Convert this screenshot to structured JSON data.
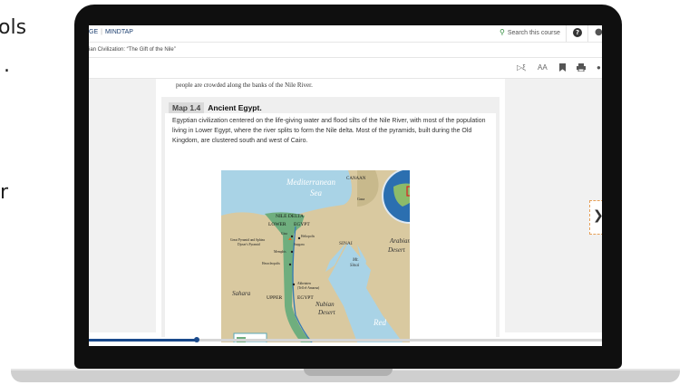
{
  "background": {
    "fragments": [
      "ols",
      ".",
      "r"
    ]
  },
  "app": {
    "brand_left": "GE",
    "brand_right": "MINDTAP",
    "search_label": "Search this course",
    "help_label": "?"
  },
  "breadcrumb": "ian Civilization: “The Gift of the Nile”",
  "toolbar": {
    "listen_label": "▷ξ",
    "text_size_label": "AA"
  },
  "page": {
    "top_line": "people are crowded along the banks of the Nile River.",
    "map_number": "Map 1.4",
    "map_title": "Ancient Egypt.",
    "caption": "Egyptian civilization centered on the life-giving water and flood silts of the Nile River, with most of the population living in Lower Egypt, where the river splits to form the Nile delta. Most of the pyramids, built during the Old Kingdom, are clustered south and west of Cairo."
  },
  "map_labels": {
    "sea_1": "Mediterranean",
    "sea_2": "Sea",
    "canaan": "CANAAN",
    "gaza": "Gaza",
    "delta": "NILE DELTA",
    "lower": "LOWER",
    "egypt": "EGYPT",
    "giza": "Giza",
    "heliopolis": "Heliopolis",
    "pyramids_1": "Great Pyramid and Sphinx",
    "pyramids_2": "Djoser's Pyramid",
    "saqqara": "Saqqara",
    "memphis": "Memphis",
    "heracleopolis": "Heracleopolis",
    "sinai": "SINAI",
    "mt": "Mt.",
    "mt_sinai": "Sinai",
    "arabian": "Arabian",
    "desert": "Desert",
    "akhetaten": "Akhetaten",
    "amarna": "(Tell el-Amarna)",
    "sahara": "Sahara",
    "upper": "UPPER",
    "egypt_upper": "EGYPT",
    "nubian": "Nubian",
    "nubian_desert": "Desert",
    "red": "Red"
  },
  "colors": {
    "accent": "#1a4a8c",
    "search_icon": "#2e8b3a",
    "sea": "#a9d3e6",
    "land": "#d9c9a0",
    "nile_valley": "#6fae7e",
    "next_border": "#e6a15a"
  },
  "progress": {
    "fraction": 0.21
  }
}
